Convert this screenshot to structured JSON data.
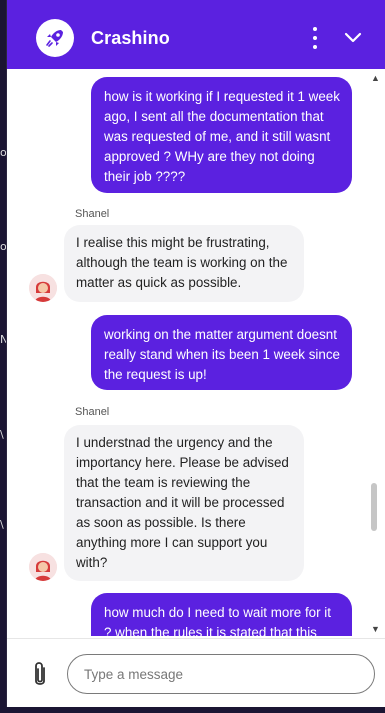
{
  "header": {
    "title": "Crashino"
  },
  "messages": [
    {
      "from": "user",
      "text": "how is it working if I requested it 1 week ago, I sent all the documentation that was requested of me, and it still wasnt approved ? WHy are they not doing their job ????"
    },
    {
      "from": "agent",
      "sender": "Shanel",
      "text": "I realise this might be frustrating, although the team is working on the matter as quick as possible."
    },
    {
      "from": "user",
      "text": "working on the matter argument doesnt really stand when its been 1 week since the request is up!"
    },
    {
      "from": "agent",
      "sender": "Shanel",
      "text": "I understnad the urgency and the importancy here. Please be advised that the team is reviewing the transaction and it will be processed as soon as possible. Is there anything more I can support you with?"
    },
    {
      "from": "user",
      "text": "how much do I need to wait more for it ? when the rules it is stated that this"
    }
  ],
  "composer": {
    "placeholder": "Type a message"
  },
  "colors": {
    "brand": "#5b21e0",
    "agent_bubble": "#f3f3f5"
  },
  "icons": {
    "logo": "rocket-logo-icon",
    "menu": "more-vertical-icon",
    "collapse": "chevron-down-icon",
    "attach": "paperclip-icon"
  }
}
